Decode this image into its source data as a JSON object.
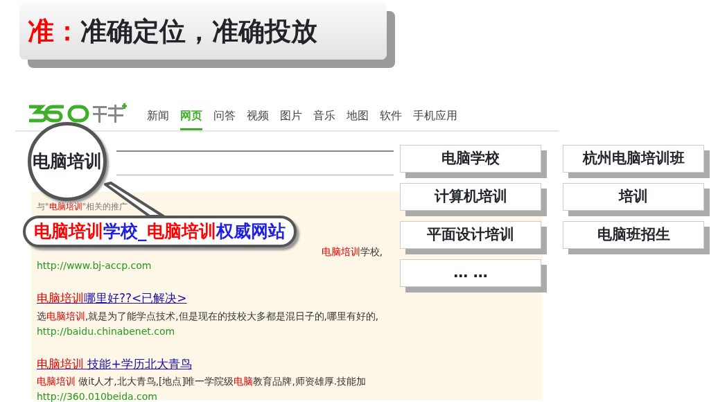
{
  "slide_title": {
    "prefix": "准：",
    "text": "准确定位，准确投放"
  },
  "search_page": {
    "nav": [
      {
        "label": "新闻",
        "selected": false
      },
      {
        "label": "网页",
        "selected": true
      },
      {
        "label": "问答",
        "selected": false
      },
      {
        "label": "视频",
        "selected": false
      },
      {
        "label": "图片",
        "selected": false
      },
      {
        "label": "音乐",
        "selected": false
      },
      {
        "label": "地图",
        "selected": false
      },
      {
        "label": "软件",
        "selected": false
      },
      {
        "label": "手机应用",
        "selected": false
      }
    ],
    "promo_label": [
      {
        "text": "与\"",
        "hl": false
      },
      {
        "text": "电脑培训",
        "hl": true
      },
      {
        "text": "\"相关的推广",
        "hl": false
      }
    ],
    "results": [
      {
        "snippet": [
          {
            "text": "电脑培训",
            "hl": true
          },
          {
            "text": "学校,",
            "hl": false
          }
        ],
        "url": "http://www.bj-accp.com"
      },
      {
        "title": [
          {
            "text": "电脑培训",
            "hl": true
          },
          {
            "text": "哪里好??<已解决>",
            "hl": false
          }
        ],
        "snippet": [
          {
            "text": "选",
            "hl": false
          },
          {
            "text": "电脑培训",
            "hl": true
          },
          {
            "text": ",就是为了能学点技术,但是现在的技校大多都是混日子的,哪里有好的,",
            "hl": false
          }
        ],
        "url": "http://baidu.chinabenet.com"
      },
      {
        "title": [
          {
            "text": "电脑培训",
            "hl": true
          },
          {
            "text": " 技能+学历北大青鸟",
            "hl": false
          }
        ],
        "snippet": [
          {
            "text": "电脑培训",
            "hl": true
          },
          {
            "text": " 做it人才,北大青鸟,[地点]唯一学院级",
            "hl": false
          },
          {
            "text": "电脑",
            "hl": true
          },
          {
            "text": "教育品牌,师资雄厚.技能加",
            "hl": false
          }
        ],
        "url": "http://360.010beida.com"
      }
    ]
  },
  "magnifier": {
    "text": "电脑培训"
  },
  "callout": [
    {
      "text": "电脑培训",
      "hl": true
    },
    {
      "text": "学校_",
      "hl": false
    },
    {
      "text": "电脑培训",
      "hl": true
    },
    {
      "text": "权威网站",
      "hl": false
    }
  ],
  "keywords": [
    [
      "电脑学校",
      "计算机培训",
      "平面设计培训",
      "… …"
    ],
    [
      "杭州电脑培训班",
      "培训",
      "电脑班招生"
    ]
  ]
}
